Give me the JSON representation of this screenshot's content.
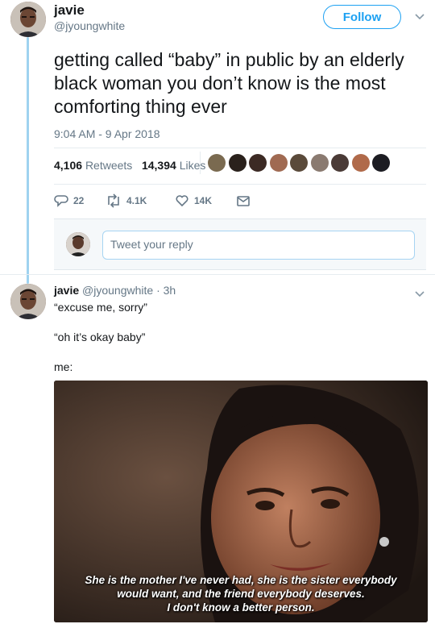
{
  "tweet": {
    "author_name": "javie",
    "author_handle": "@jyoungwhite",
    "follow_label": "Follow",
    "text": "getting called “baby” in public by an elderly black woman you don’t know is the most comforting thing ever",
    "timestamp": "9:04 AM - 9 Apr 2018",
    "retweets_count": "4,106",
    "retweets_label": "Retweets",
    "likes_count": "14,394",
    "likes_label": "Likes",
    "replies_action": "22",
    "retweets_action": "4.1K",
    "likes_action": "14K"
  },
  "reply_composer": {
    "placeholder": "Tweet your reply"
  },
  "reply": {
    "author_name": "javie",
    "meta": "@jyoungwhite · 3h",
    "lines": [
      "“excuse me, sorry”",
      "“oh it’s okay baby”",
      "me:"
    ]
  },
  "meme": {
    "caption_lines": [
      "She is the mother I've never had, she is the sister everybody",
      "would want, and the friend everybody deserves.",
      "I don't know a better person."
    ]
  },
  "colors": {
    "accent": "#1da1f2",
    "thread_line": "#9fd3f0",
    "text_primary": "#14171a",
    "text_secondary": "#657786"
  },
  "icons": [
    "reply-icon",
    "retweet-icon",
    "like-icon",
    "direct-message-icon",
    "chevron-down-icon"
  ]
}
